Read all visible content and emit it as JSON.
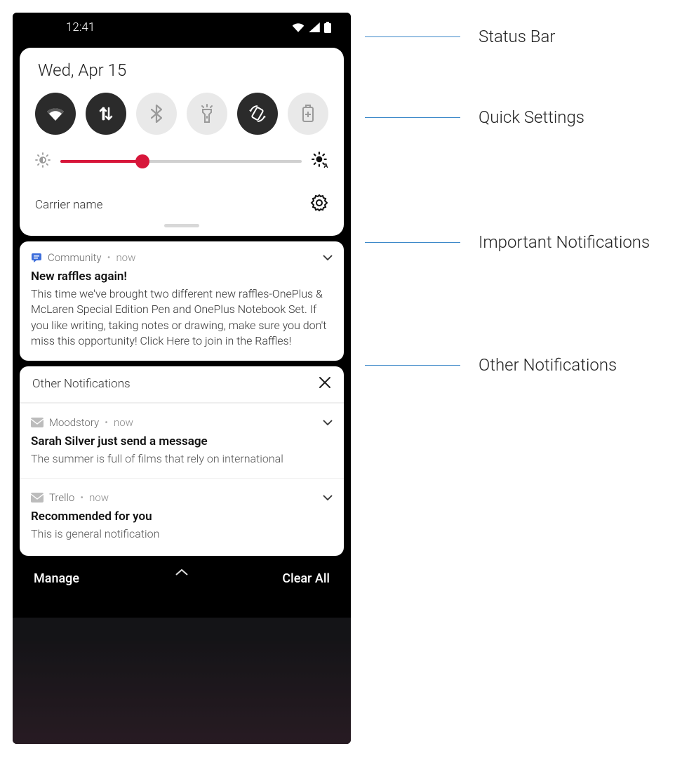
{
  "status": {
    "time": "12:41"
  },
  "quick_settings": {
    "date": "Wed, Apr 15",
    "carrier": "Carrier name"
  },
  "important_notif": {
    "app": "Community",
    "time": "now",
    "title": "New raffles again!",
    "body": "This time we've brought two different new raffles-OnePlus & McLaren Special Edition Pen and OnePlus Notebook Set. If you like writing, taking notes or drawing, make sure you don't miss this opportunity! Click Here to join in the Raffles!"
  },
  "other": {
    "section_title": "Other Notifications",
    "items": [
      {
        "app": "Moodstory",
        "time": "now",
        "title": "Sarah Silver just send a message",
        "body": "The summer is full of films that rely on international"
      },
      {
        "app": "Trello",
        "time": "now",
        "title": "Recommended for you",
        "body": "This is general notification"
      }
    ]
  },
  "bottom": {
    "manage": "Manage",
    "clear": "Clear All"
  },
  "annotations": {
    "status_bar": "Status Bar",
    "quick_settings": "Quick Settings",
    "important": "Important Notifications",
    "other": "Other Notifications"
  }
}
